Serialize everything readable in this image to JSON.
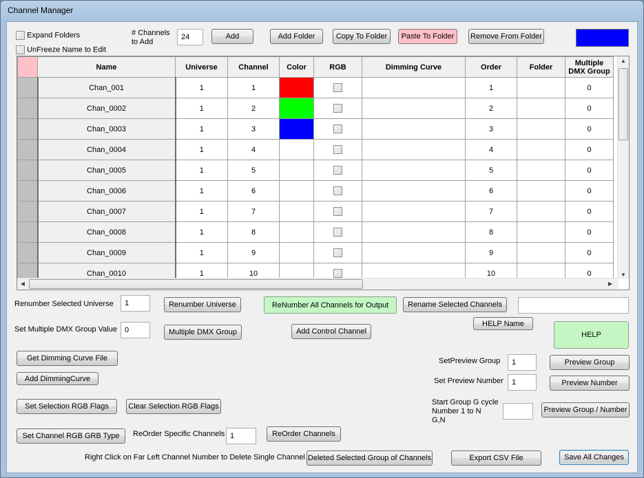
{
  "window": {
    "title": "Channel Manager"
  },
  "toolbar": {
    "expand_folders_label": "Expand Folders",
    "unfreeze_label": "UnFreeze Name to Edit",
    "channels_to_add_label_1": "# Channels",
    "channels_to_add_label_2": "to Add",
    "channels_to_add_value": "24",
    "add_button": "Add",
    "add_folder_button": "Add Folder",
    "copy_to_folder_button": "Copy To Folder",
    "paste_to_folder_button": "Paste To Folder",
    "remove_from_folder_button": "Remove From Folder",
    "color_swatch": "#0000ff"
  },
  "grid": {
    "columns": [
      "Name",
      "Universe",
      "Channel",
      "Color",
      "RGB",
      "Dimming Curve",
      "Order",
      "Folder",
      "Multiple DMX Group"
    ],
    "rows": [
      {
        "name": "Chan_001",
        "universe": "1",
        "channel": "1",
        "color": "#ff0000",
        "order": "1",
        "folder": "",
        "dmx_group": "0"
      },
      {
        "name": "Chan_0002",
        "universe": "1",
        "channel": "2",
        "color": "#00ff00",
        "order": "2",
        "folder": "",
        "dmx_group": "0"
      },
      {
        "name": "Chan_0003",
        "universe": "1",
        "channel": "3",
        "color": "#0000ff",
        "order": "3",
        "folder": "",
        "dmx_group": "0"
      },
      {
        "name": "Chan_0004",
        "universe": "1",
        "channel": "4",
        "color": "",
        "order": "4",
        "folder": "",
        "dmx_group": "0"
      },
      {
        "name": "Chan_0005",
        "universe": "1",
        "channel": "5",
        "color": "",
        "order": "5",
        "folder": "",
        "dmx_group": "0"
      },
      {
        "name": "Chan_0006",
        "universe": "1",
        "channel": "6",
        "color": "",
        "order": "6",
        "folder": "",
        "dmx_group": "0"
      },
      {
        "name": "Chan_0007",
        "universe": "1",
        "channel": "7",
        "color": "",
        "order": "7",
        "folder": "",
        "dmx_group": "0"
      },
      {
        "name": "Chan_0008",
        "universe": "1",
        "channel": "8",
        "color": "",
        "order": "8",
        "folder": "",
        "dmx_group": "0"
      },
      {
        "name": "Chan_0009",
        "universe": "1",
        "channel": "9",
        "color": "",
        "order": "9",
        "folder": "",
        "dmx_group": "0"
      },
      {
        "name": "Chan_0010",
        "universe": "1",
        "channel": "10",
        "color": "",
        "order": "10",
        "folder": "",
        "dmx_group": "0"
      }
    ]
  },
  "controls": {
    "renumber_universe_label": "Renumber Selected Universe",
    "renumber_universe_value": "1",
    "renumber_universe_button": "Renumber Universe",
    "renumber_all_button": "ReNumber All Channels for Output",
    "rename_selected_button": "Rename Selected Channels",
    "rename_value": "",
    "set_dmx_group_label": "Set Multiple DMX Group Value",
    "set_dmx_group_value": "0",
    "multiple_dmx_group_button": "Multiple DMX Group",
    "add_control_channel_button": "Add Control Channel",
    "help_name_button": "HELP Name",
    "help_button": "HELP",
    "get_dimming_curve_button": "Get Dimming Curve File",
    "add_dimming_curve_button": "Add DimmingCurve",
    "set_preview_group_label": "SetPreview Group",
    "set_preview_group_value": "1",
    "preview_group_button": "Preview Group",
    "set_preview_number_label": "Set Preview Number",
    "set_preview_number_value": "1",
    "preview_number_button": "Preview Number",
    "set_rgb_flags_button": "Set Selection RGB Flags",
    "clear_rgb_flags_button": "Clear Selection RGB Flags",
    "start_group_label_1": "Start Group G cycle",
    "start_group_label_2": "Number 1 to N",
    "start_group_label_3": "G,N",
    "start_group_value": "",
    "preview_group_number_button": "Preview Group / Number",
    "set_rgb_grb_button": "Set Channel RGB GRB Type",
    "reorder_specific_label": "ReOrder Specific Channels",
    "reorder_specific_value": "1",
    "reorder_button": "ReOrder Channels",
    "right_click_hint": "Right Click on Far Left Channel Number to Delete Single Channel",
    "delete_group_button": "Deleted Selected Group of Channels",
    "export_csv_button": "Export CSV File",
    "save_all_button": "Save All Changes"
  }
}
